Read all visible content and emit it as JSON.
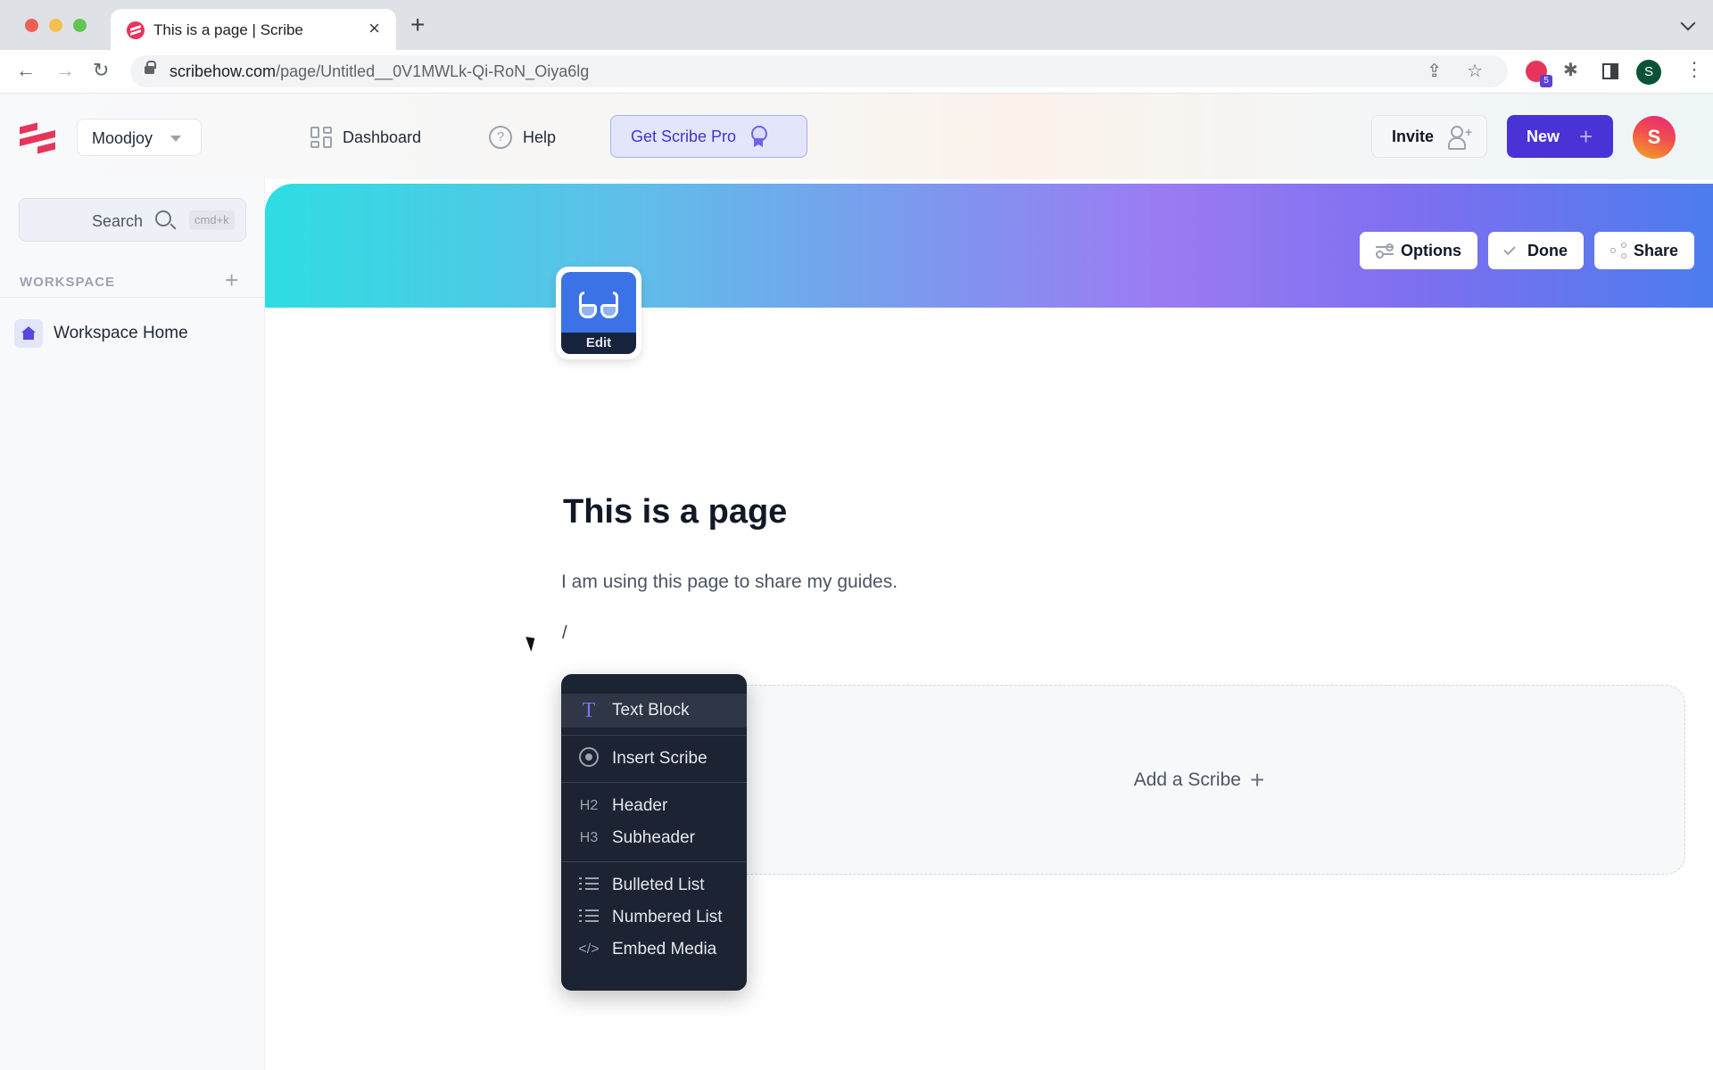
{
  "browser": {
    "tab_title": "This is a page | Scribe",
    "tab_close": "×",
    "new_tab": "+",
    "url_host": "scribehow.com",
    "url_path": "/page/Untitled__0V1MWLk-Qi-RoN_Oiya6lg",
    "nav": {
      "back": "←",
      "forward": "→",
      "reload": "↻"
    },
    "share_glyph": "⇪",
    "bookmark_glyph": "☆",
    "extension_badge": "5",
    "puzzle_glyph": "✱",
    "profile_initial": "S",
    "menu_glyph": "⋮"
  },
  "header": {
    "workspace": "Moodjoy",
    "nav": [
      {
        "label": "Dashboard",
        "icon": "dashboard-grid-icon"
      },
      {
        "label": "Help",
        "icon": "help-circle-icon",
        "glyph": "?"
      }
    ],
    "pro_button": "Get Scribe Pro",
    "invite_button": "Invite",
    "invite_plus": "+",
    "new_button": "New",
    "new_plus": "+",
    "avatar_initial": "S"
  },
  "sidebar": {
    "search_label": "Search",
    "search_shortcut": "cmd+k",
    "workspace_heading": "WORKSPACE",
    "workspace_add": "+",
    "items": [
      {
        "label": "Workspace Home",
        "icon": "home-icon"
      }
    ]
  },
  "page": {
    "actions": [
      {
        "label": "Options",
        "icon": "options-icon"
      },
      {
        "label": "Done",
        "icon": "check-icon"
      },
      {
        "label": "Share",
        "icon": "share-icon"
      }
    ],
    "icon_edit_label": "Edit",
    "title": "This is a page",
    "description": "I am using this page to share my guides.",
    "slash_input": "/",
    "add_scribe_label": "Add a Scribe",
    "add_scribe_plus": "+"
  },
  "slash_menu": {
    "items": [
      {
        "label": "Text Block",
        "icon": "text-block-icon",
        "glyph": "T",
        "active": true
      },
      {
        "label": "Insert Scribe",
        "icon": "insert-scribe-icon"
      },
      {
        "label": "Header",
        "icon": "h2-icon",
        "glyph": "H2"
      },
      {
        "label": "Subheader",
        "icon": "h3-icon",
        "glyph": "H3"
      },
      {
        "label": "Bulleted List",
        "icon": "bulleted-list-icon"
      },
      {
        "label": "Numbered List",
        "icon": "numbered-list-icon"
      },
      {
        "label": "Embed Media",
        "icon": "embed-code-icon",
        "glyph": "</>"
      }
    ]
  },
  "colors": {
    "brand_red": "#e8345a",
    "primary_purple": "#4a33d6",
    "pro_bg": "#e3e5fb",
    "menu_bg": "#1c2333",
    "banner_start": "#2edde3",
    "banner_end": "#4c7ded"
  }
}
